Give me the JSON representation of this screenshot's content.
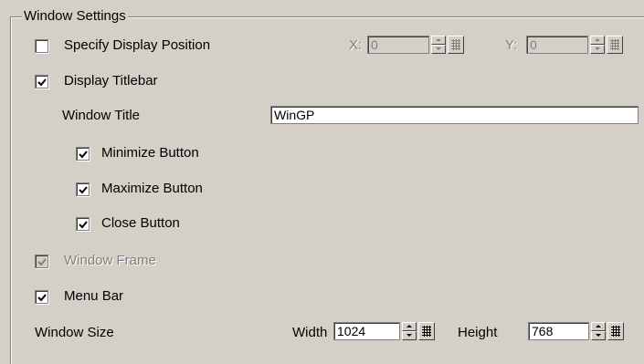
{
  "group_title": "Window Settings",
  "specify_display_position": {
    "label": "Specify Display Position",
    "checked": false
  },
  "position": {
    "x_label": "X:",
    "x_value": "0",
    "y_label": "Y:",
    "y_value": "0"
  },
  "display_titlebar": {
    "label": "Display Titlebar",
    "checked": true
  },
  "window_title": {
    "label": "Window Title",
    "value": "WinGP"
  },
  "minimize_button": {
    "label": "Minimize Button",
    "checked": true
  },
  "maximize_button": {
    "label": "Maximize Button",
    "checked": true
  },
  "close_button": {
    "label": "Close Button",
    "checked": true
  },
  "window_frame": {
    "label": "Window Frame",
    "checked": true,
    "disabled": true
  },
  "menu_bar": {
    "label": "Menu Bar",
    "checked": true
  },
  "window_size": {
    "label": "Window Size",
    "width_label": "Width",
    "width_value": "1024",
    "height_label": "Height",
    "height_value": "768"
  },
  "icons": {
    "checkbox_check": "check-mark",
    "spinner": "up-down-arrows",
    "keypad": "grid-keypad-icon"
  },
  "colors": {
    "face": "#d4d0c8",
    "shadow": "#808080",
    "highlight": "#ffffff",
    "disabled_text": "#808080"
  }
}
